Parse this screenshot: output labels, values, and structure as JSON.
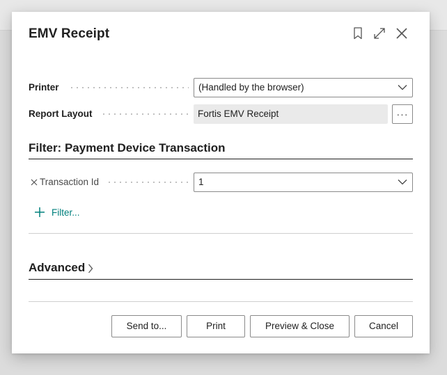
{
  "dialog": {
    "title": "EMV Receipt",
    "header_icons": [
      "bookmark-icon",
      "expand-icon",
      "close-icon"
    ]
  },
  "fields": {
    "printer": {
      "label": "Printer",
      "value": "(Handled by the browser)"
    },
    "report_layout": {
      "label": "Report Layout",
      "value": "Fortis EMV Receipt",
      "lookup_label": "···"
    }
  },
  "filter_section": {
    "title": "Filter: Payment Device Transaction",
    "filters": [
      {
        "label": "Transaction Id",
        "value": "1"
      }
    ],
    "add_filter_label": "Filter..."
  },
  "advanced": {
    "label": "Advanced"
  },
  "footer": {
    "send_to_label": "Send to...",
    "print_label": "Print",
    "preview_close_label": "Preview & Close",
    "cancel_label": "Cancel"
  },
  "colors": {
    "accent": "#00807d",
    "text": "#212121",
    "border": "#8a8a8a",
    "readonly_bg": "#eaeaea"
  }
}
